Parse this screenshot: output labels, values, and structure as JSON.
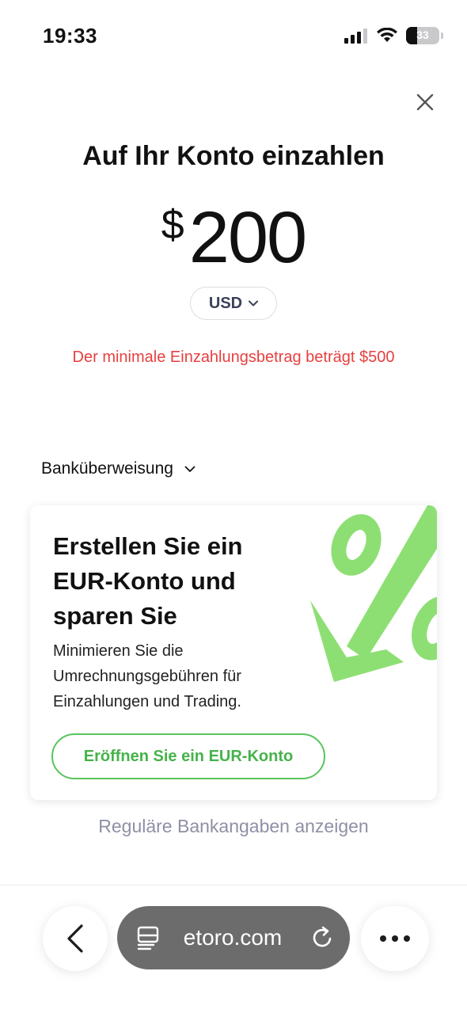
{
  "status_bar": {
    "time": "19:33",
    "battery_level": "33",
    "battery_fraction": 0.33,
    "icons": [
      "cellular-signal-icon",
      "wifi-icon",
      "battery-icon"
    ]
  },
  "header": {
    "title": "Auf Ihr Konto einzahlen",
    "close_icon": "close-icon"
  },
  "deposit": {
    "currency_symbol": "$",
    "amount": "200",
    "currency_code": "USD",
    "error_message": "Der minimale Einzahlungsbetrag beträgt $500"
  },
  "payment_method": {
    "selected": "Banküberweisung"
  },
  "promo": {
    "title": "Erstellen Sie ein EUR-Konto und sparen Sie",
    "description": "Minimieren Sie die Umrechnungsgebühren für Einzahlungen und Trading.",
    "button_label": "Eröffnen Sie ein EUR-Konto",
    "art_icon": "percent-down-arrow-icon"
  },
  "bank_details_link": "Reguläre Bankangaben anzeigen",
  "browser": {
    "url": "etoro.com",
    "icons": [
      "back-icon",
      "tab-icon",
      "reload-icon",
      "more-icon"
    ]
  },
  "colors": {
    "error": "#e83f3f",
    "accent_green": "#58c35d",
    "link_gray": "#8e90a6",
    "url_pill": "#6c6c6c"
  }
}
